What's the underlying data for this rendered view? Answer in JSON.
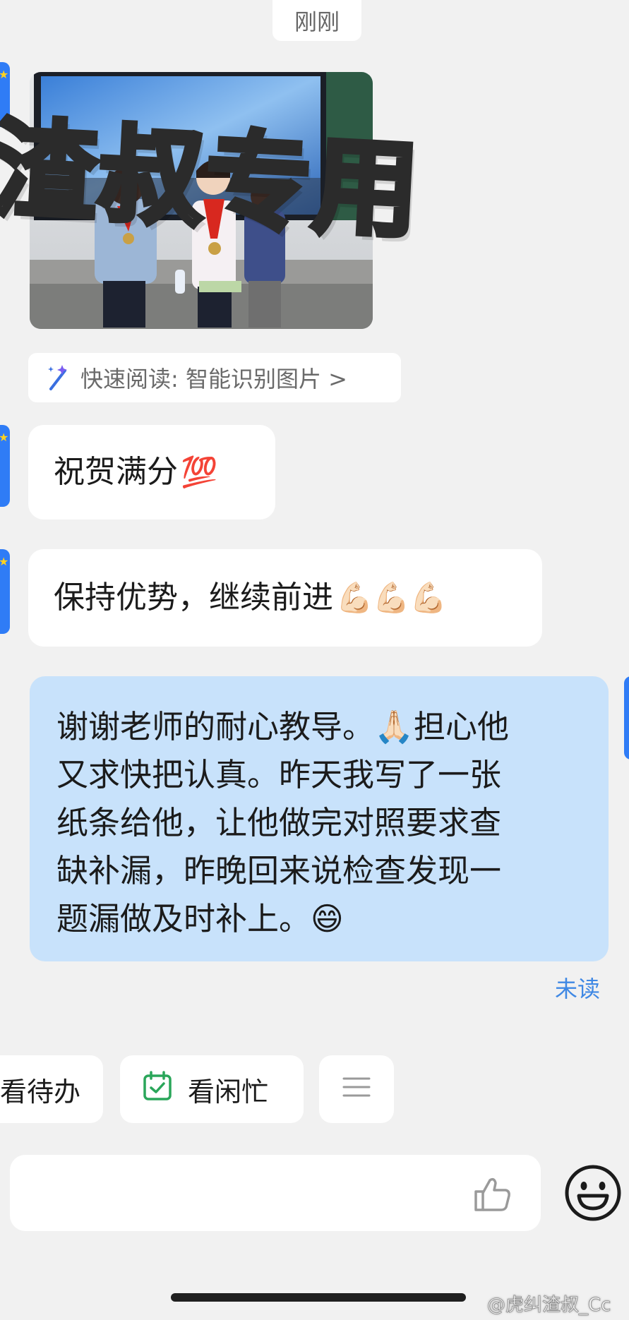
{
  "timestamp": "刚刚",
  "watermark_text": "渣叔专用",
  "image_message": {
    "alt": "三名学生佩戴红领巾和奖牌在教室前合影"
  },
  "quick_read": {
    "label": "快速阅读: 智能识别图片 >",
    "icon": "magic-wand-icon"
  },
  "messages": [
    {
      "direction": "incoming",
      "text": "祝贺满分",
      "emoji": "💯"
    },
    {
      "direction": "incoming",
      "text": "保持优势，继续前进",
      "emoji": "💪🏻💪🏻💪🏻"
    },
    {
      "direction": "outgoing",
      "lines": [
        "谢谢老师的耐心教导。🙏🏻担心他",
        "又求快把认真。昨天我写了一张",
        "纸条给他，让他做完对照要求查",
        "缺补漏，昨晚回来说检查发现一",
        "题漏做及时补上。😄"
      ],
      "status": "未读"
    }
  ],
  "quick_actions": [
    {
      "label": "看待办"
    },
    {
      "label": "看闲忙",
      "icon": "calendar-check-icon"
    },
    {
      "label": "",
      "icon": "menu-icon"
    }
  ],
  "input": {
    "placeholder": "",
    "value": ""
  },
  "icons": {
    "like": "thumbs-up-icon",
    "emoji": "smiley-face-icon"
  },
  "colors": {
    "background": "#f1f1f1",
    "incoming_bubble": "#ffffff",
    "outgoing_bubble": "#c8e2fb",
    "unread": "#3f88e4",
    "avatar": "#2f7cf6",
    "calendar_check": "#2aa65a"
  },
  "footer_watermark": "@虎纠渣叔_Cc"
}
